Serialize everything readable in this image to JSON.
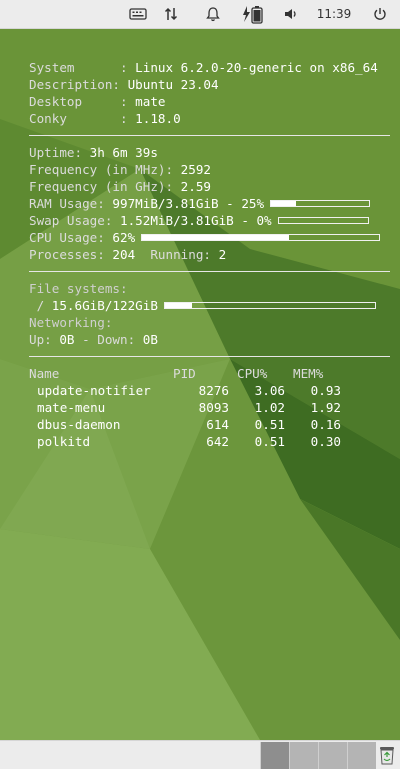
{
  "top_panel": {
    "icons": [
      "keyboard-icon",
      "network-arrows-icon",
      "bell-icon",
      "battery-charging-icon",
      "speaker-icon",
      "power-icon"
    ],
    "clock": "11:39"
  },
  "conky": {
    "system": [
      {
        "label": "System     ",
        "value": "Linux 6.2.0-20-generic on x86_64"
      },
      {
        "label": "Description",
        "value": "Ubuntu 23.04"
      },
      {
        "label": "Desktop    ",
        "value": "mate"
      },
      {
        "label": "Conky      ",
        "value": "1.18.0"
      }
    ],
    "uptime": {
      "label": "Uptime:",
      "value": "3h 6m 39s"
    },
    "freq_mhz": {
      "label": "Frequency (in MHz):",
      "value": "2592"
    },
    "freq_ghz": {
      "label": "Frequency (in GHz):",
      "value": "2.59"
    },
    "ram": {
      "label": "RAM Usage:",
      "value": "997MiB/3.81GiB - 25%",
      "percent": 25
    },
    "swap": {
      "label": "Swap Usage:",
      "value": "1.52MiB/3.81GiB - 0%",
      "percent": 0
    },
    "cpu": {
      "label": "CPU Usage:",
      "value": "62%",
      "percent": 62
    },
    "processes": {
      "label": "Processes:",
      "value": "204",
      "running_label": "Running:",
      "running_value": "2"
    },
    "filesystems": {
      "label": "File systems:",
      "mount": " / ",
      "value": "15.6GiB/122GiB",
      "percent": 13
    },
    "networking": {
      "label": "Networking:",
      "up_label": "Up:",
      "up_value": "0B",
      "down_label": " - Down:",
      "down_value": "0B"
    },
    "top_header": {
      "name": "Name",
      "pid": "PID",
      "cpu": "CPU%",
      "mem": "MEM%"
    },
    "top": [
      {
        "name": "update-notifier",
        "pid": "8276",
        "cpu": "3.06",
        "mem": "0.93"
      },
      {
        "name": "mate-menu",
        "pid": "8093",
        "cpu": "1.02",
        "mem": "1.92"
      },
      {
        "name": "dbus-daemon",
        "pid": "614",
        "cpu": "0.51",
        "mem": "0.16"
      },
      {
        "name": "polkitd",
        "pid": "642",
        "cpu": "0.51",
        "mem": "0.30"
      }
    ]
  },
  "bottom_panel": {
    "workspaces": 4,
    "active_workspace": 1,
    "colors": {
      "panel": "#ececec",
      "workspace": "#b4b4b4",
      "workspace_active": "#8e8e8e"
    }
  },
  "colors": {
    "desktop": "#6f9a3f",
    "text": "#ffffff"
  }
}
